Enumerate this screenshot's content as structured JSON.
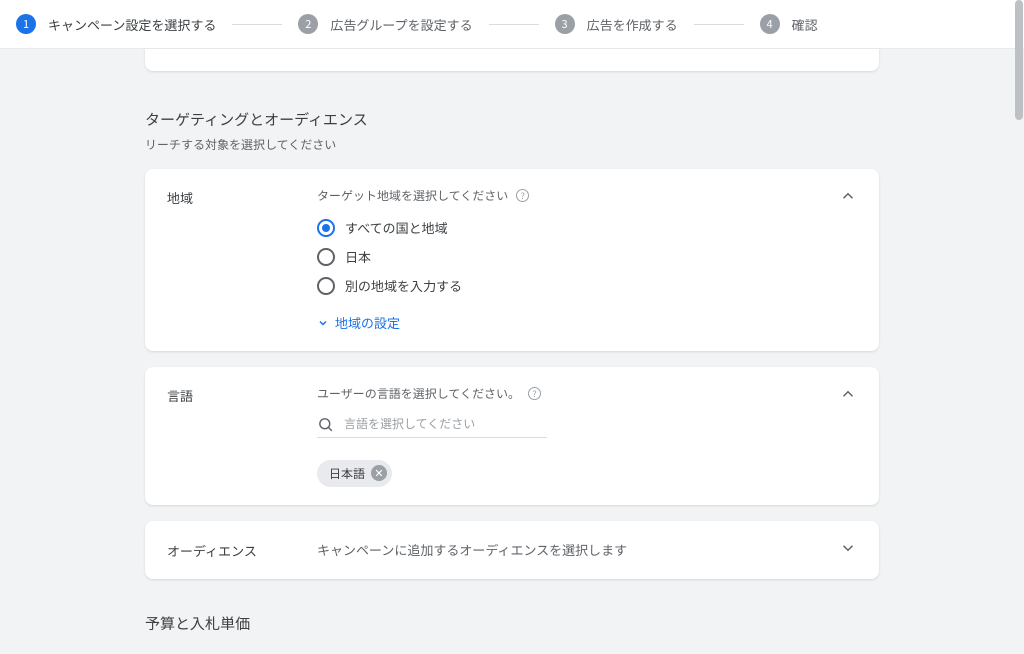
{
  "stepper": {
    "steps": [
      {
        "num": "1",
        "label": "キャンペーン設定を選択する",
        "active": true
      },
      {
        "num": "2",
        "label": "広告グループを設定する",
        "active": false
      },
      {
        "num": "3",
        "label": "広告を作成する",
        "active": false
      },
      {
        "num": "4",
        "label": "確認",
        "active": false
      }
    ]
  },
  "targeting": {
    "title": "ターゲティングとオーディエンス",
    "subtitle": "リーチする対象を選択してください"
  },
  "location": {
    "label": "地域",
    "help": "ターゲット地域を選択してください",
    "options": [
      {
        "label": "すべての国と地域",
        "selected": true
      },
      {
        "label": "日本",
        "selected": false
      },
      {
        "label": "別の地域を入力する",
        "selected": false
      }
    ],
    "expand_link": "地域の設定"
  },
  "language": {
    "label": "言語",
    "help": "ユーザーの言語を選択してください。",
    "search_placeholder": "言語を選択してください",
    "chip": "日本語"
  },
  "audience": {
    "label": "オーディエンス",
    "body": "キャンペーンに追加するオーディエンスを選択します"
  },
  "budget": {
    "title": "予算と入札単価"
  }
}
